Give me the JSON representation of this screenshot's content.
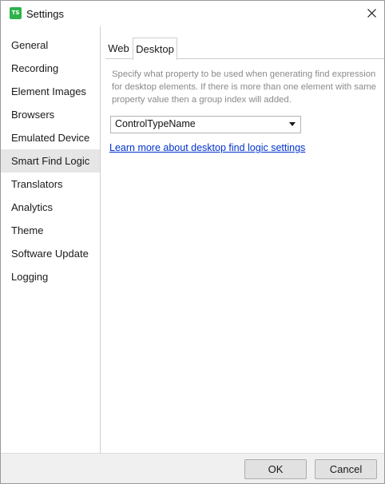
{
  "window": {
    "title": "Settings",
    "app_icon_text": "TS",
    "accent_color": "#2db34a"
  },
  "sidebar": {
    "items": [
      {
        "label": "General",
        "selected": false
      },
      {
        "label": "Recording",
        "selected": false
      },
      {
        "label": "Element Images",
        "selected": false
      },
      {
        "label": "Browsers",
        "selected": false
      },
      {
        "label": "Emulated Device",
        "selected": false
      },
      {
        "label": "Smart Find Logic",
        "selected": true
      },
      {
        "label": "Translators",
        "selected": false
      },
      {
        "label": "Analytics",
        "selected": false
      },
      {
        "label": "Theme",
        "selected": false
      },
      {
        "label": "Software Update",
        "selected": false
      },
      {
        "label": "Logging",
        "selected": false
      }
    ]
  },
  "tabs": [
    {
      "label": "Web",
      "active": false
    },
    {
      "label": "Desktop",
      "active": true
    }
  ],
  "content": {
    "description": "Specify what property to be used when generating find expression for desktop elements. If there is more than one element with same property value then a group index will added.",
    "dropdown_value": "ControlTypeName",
    "link_text": "Learn more about desktop find logic settings",
    "link_color": "#0033cc"
  },
  "footer": {
    "ok_label": "OK",
    "cancel_label": "Cancel"
  },
  "icons": {
    "close": "close-icon",
    "dropdown": "chevron-down-icon",
    "app": "app-logo-icon"
  }
}
